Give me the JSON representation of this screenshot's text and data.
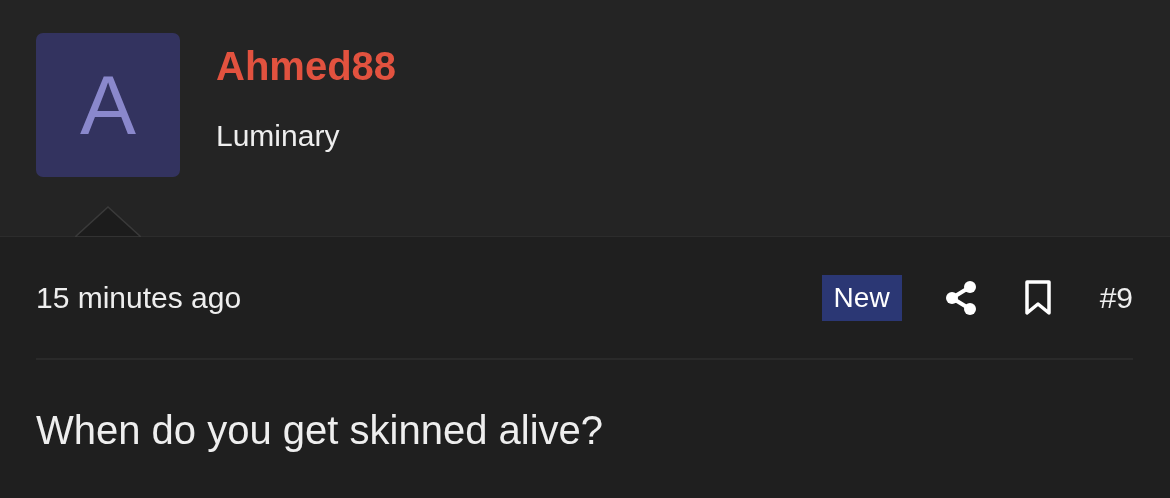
{
  "author": {
    "avatar_letter": "A",
    "name": "Ahmed88",
    "title": "Luminary"
  },
  "post": {
    "time": "15 minutes ago",
    "badge": "New",
    "number": "#9",
    "body": "When do you get skinned alive?"
  }
}
